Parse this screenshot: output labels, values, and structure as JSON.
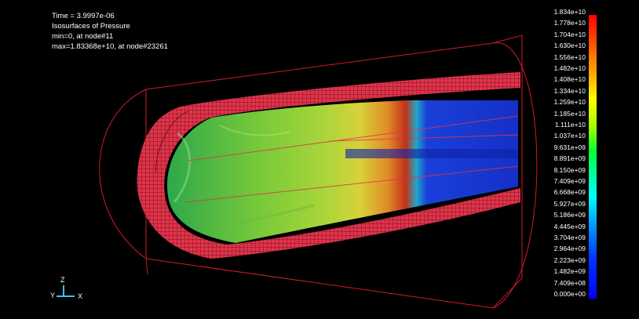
{
  "header": {
    "time_line": "Time =  3.9997e-06",
    "result_type": "Isosurfaces of Pressure",
    "min_line": "min=0, at node#11",
    "max_line": "max=1.83368e+10, at node#23261"
  },
  "legend": {
    "labels": [
      "1.834e+10",
      "1.778e+10",
      "1.704e+10",
      "1.630e+10",
      "1.556e+10",
      "1.482e+10",
      "1.408e+10",
      "1.334e+10",
      "1.259e+10",
      "1.185e+10",
      "1.111e+10",
      "1.037e+10",
      "9.631e+09",
      "8.891e+09",
      "8.150e+09",
      "7.409e+09",
      "6.668e+09",
      "5.927e+09",
      "5.186e+09",
      "4.445e+09",
      "3.704e+09",
      "2.964e+09",
      "2.223e+09",
      "1.482e+09",
      "7.409e+08",
      "0.000e+00"
    ],
    "colors": {
      "max": "#ff0000",
      "mid": "#00ff33",
      "min": "#0000ff"
    }
  },
  "triad": {
    "z": "Z",
    "y": "Y",
    "x": "X"
  },
  "colors": {
    "mesh": "#e0334a",
    "outline": "#d01a2a",
    "background": "#000000"
  }
}
